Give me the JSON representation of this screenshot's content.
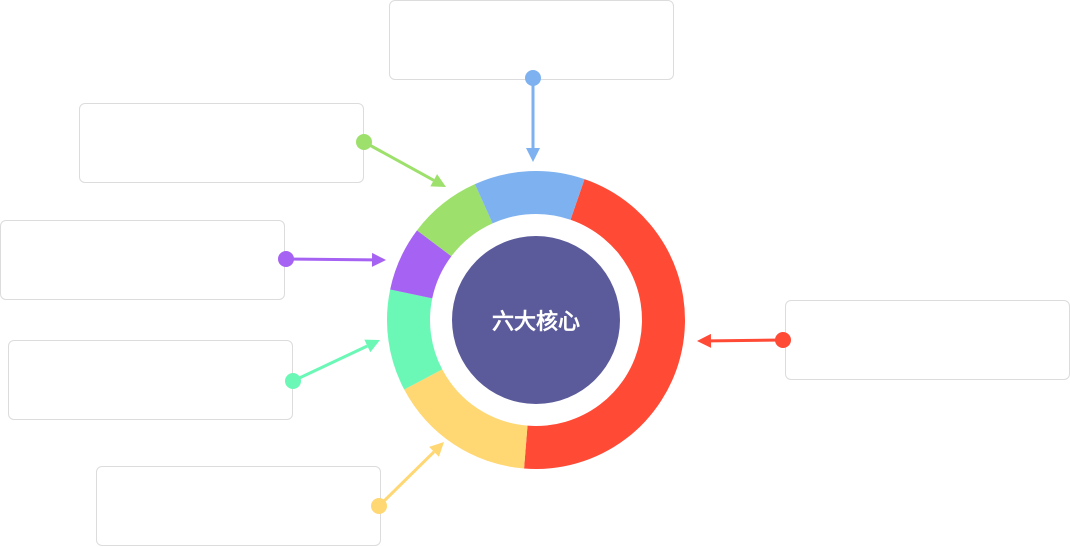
{
  "center": {
    "label": "六大核心",
    "color": "#5b5b9b"
  },
  "ring": {
    "segments": [
      {
        "name": "red",
        "color": "#ff4a36",
        "share": 0.46
      },
      {
        "name": "yellow",
        "color": "#ffd773",
        "share": 0.16
      },
      {
        "name": "teal",
        "color": "#6bf8b6",
        "share": 0.11
      },
      {
        "name": "purple",
        "color": "#a663f3",
        "share": 0.07
      },
      {
        "name": "green",
        "color": "#9de06b",
        "share": 0.08
      },
      {
        "name": "blue",
        "color": "#7eb1f0",
        "share": 0.12
      }
    ]
  },
  "callouts": [
    {
      "name": "top",
      "color": "#7eb1f0"
    },
    {
      "name": "green",
      "color": "#9de06b"
    },
    {
      "name": "purple",
      "color": "#a663f3"
    },
    {
      "name": "teal",
      "color": "#6bf8b6"
    },
    {
      "name": "yellow",
      "color": "#ffd773"
    },
    {
      "name": "right",
      "color": "#ff4a36"
    }
  ]
}
